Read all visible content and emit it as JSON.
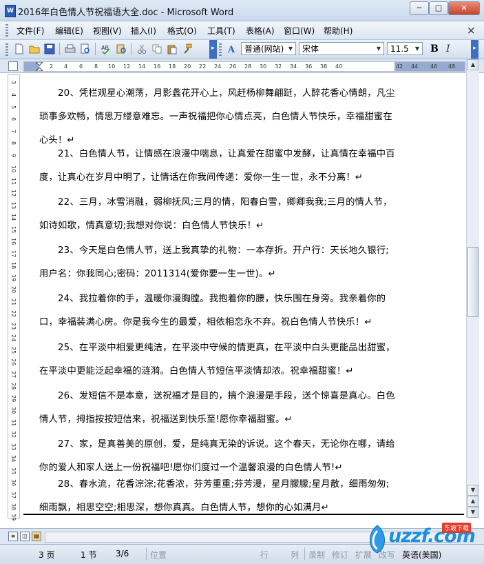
{
  "window": {
    "title": "2016年白色情人节祝福语大全.doc - Microsoft Word",
    "minimize": "─",
    "maximize": "□",
    "close": "✕"
  },
  "menu": {
    "items": [
      "文件(F)",
      "编辑(E)",
      "视图(V)",
      "插入(I)",
      "格式(O)",
      "工具(T)",
      "表格(A)",
      "窗口(W)",
      "帮助(H)"
    ],
    "close_doc": "×"
  },
  "toolbar": {
    "style": "普通(网站)",
    "font": "宋体",
    "size": "11.5",
    "bold": "B",
    "italic": "I",
    "style_icon": "A"
  },
  "ruler": {
    "numbers": [
      "2",
      "4",
      "6",
      "8",
      "10",
      "12",
      "14",
      "16",
      "18",
      "20",
      "22",
      "24",
      "26",
      "28",
      "30",
      "32",
      "34",
      "36",
      "38",
      "40",
      "42",
      "44",
      "46",
      "48"
    ]
  },
  "vruler": {
    "numbers": [
      "3",
      "4",
      "5",
      "6",
      "7",
      "8",
      "9",
      "10",
      "11",
      "12",
      "13",
      "14",
      "15",
      "16",
      "17",
      "18",
      "19",
      "20",
      "21",
      "22",
      "23",
      "24",
      "25",
      "26",
      "27",
      "28",
      "29",
      "30",
      "31",
      "32",
      "33",
      "34",
      "35",
      "36",
      "37",
      "38",
      "39"
    ]
  },
  "document": {
    "paragraphs": [
      "20、凭栏观星心潮荡，月影蠡花开心上，风赶杨柳舞翩跹，人醉花香心情朗，凡尘琐事多欢畅，情思万缕意难忘。一声祝福把你心情点亮，白色情人节快乐，幸福甜蜜在心头！↵",
      "21、白色情人节，让情感在浪漫中喘息，让真爱在甜蜜中发酵，让真情在幸福中百度，让真心在岁月中明了，让情话在你我间传递：爱你一生一世，永不分离！↵",
      "22、三月，冰雪消融，弱柳抚风;三月的情，阳春白雪，卿卿我我;三月的情人节，如诗如歌，情真意切;我想对你说：白色情人节快乐！↵",
      "23、今天是白色情人节，送上我真挚的礼物：一本存折。开户行：天长地久银行;用户名：你我同心;密码：2011314(爱你要一生一世)。↵",
      "24、我拉着你的手，温暖你漫胸膛。我抱着你的腰，快乐围在身旁。我亲着你的口，幸福装满心房。你是我今生的最爱，相依相恋永不弃。祝白色情人节快乐！↵",
      "25、在平淡中相爱更纯洁，在平淡中守候的情更真，在平淡中白头更能品出甜蜜，在平淡中更能泛起幸福的涟漪。白色情人节短信平淡情却浓。祝幸福甜蜜！↵",
      "26、发短信不是本意，送祝福才是目的，搞个浪漫是手段，送个惊喜是真心。白色情人节，拇指按按短信来，祝福送到快乐至!愿你幸福甜蜜。↵",
      "27、家，是真善美的原创，爱，是纯真无染的诉说。这个春天，无论你在哪，请给你的爱人和家人送上一份祝福吧!愿你们度过一个温馨浪漫的白色情人节!↵",
      "28、春水流，花香淙淙;花香浓，芬芳重重;芬芳漫，星月朦朦;星月散，细雨匆匆;细雨飘，相思空空;相思深，想你真真。白色情人节，想你的心如满月↵"
    ]
  },
  "statusbar": {
    "page": "3 页",
    "section": "1 节",
    "page_of": "3/6",
    "position": "位置",
    "line": "行",
    "column": "列",
    "rec": "录制",
    "trk": "修订",
    "ext": "扩展",
    "ovr": "改写",
    "language": "英语(美国)"
  },
  "watermark": {
    "text": "uzzf.com",
    "sub": "东坡下载"
  }
}
